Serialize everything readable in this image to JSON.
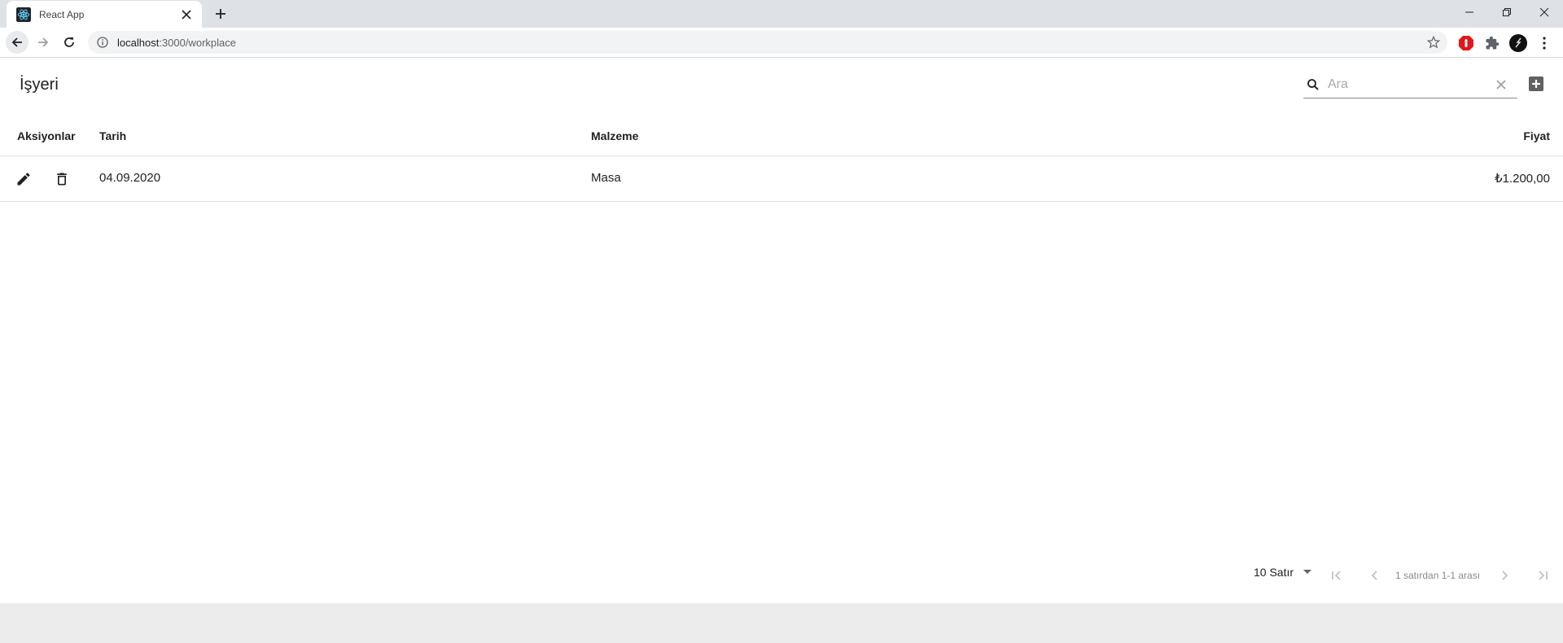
{
  "browser": {
    "tab_title": "React App",
    "url_host": "localhost",
    "url_path": ":3000/workplace"
  },
  "page": {
    "title": "İşyeri",
    "search_placeholder": "Ara"
  },
  "table": {
    "columns": [
      "Aksiyonlar",
      "Tarih",
      "Malzeme",
      "Fiyat"
    ],
    "rows": [
      {
        "date": "04.09.2020",
        "material": "Masa",
        "price": "₺1.200,00"
      }
    ]
  },
  "pagination": {
    "rows_per_page": "10 Satır",
    "info": "1 satırdan 1-1 arası"
  },
  "colors": {
    "react_blue": "#61dafb",
    "toolbar_bg": "#dee1e6",
    "ext_red": "#e4161a"
  }
}
